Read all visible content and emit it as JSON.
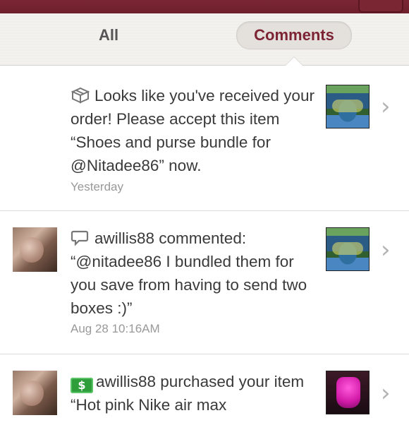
{
  "tabs": {
    "all": "All",
    "comments": "Comments",
    "active": "comments"
  },
  "colors": {
    "brand": "#7c2433",
    "money": "#2e9e3b"
  },
  "items": [
    {
      "icon": "box-icon",
      "text": "Looks like you've received your order! Please accept this item “Shoes and purse bundle for @Nitadee86” now.",
      "time": "Yesterday"
    },
    {
      "icon": "comment-bubble-icon",
      "text": "awillis88 commented: “@nitadee86 I bundled them for you save from having to send two boxes :)”",
      "time": "Aug 28 10:16AM"
    },
    {
      "icon": "money-icon",
      "icon_text": "$",
      "text": "awillis88 purchased your item “Hot pink Nike air max",
      "time": ""
    }
  ]
}
